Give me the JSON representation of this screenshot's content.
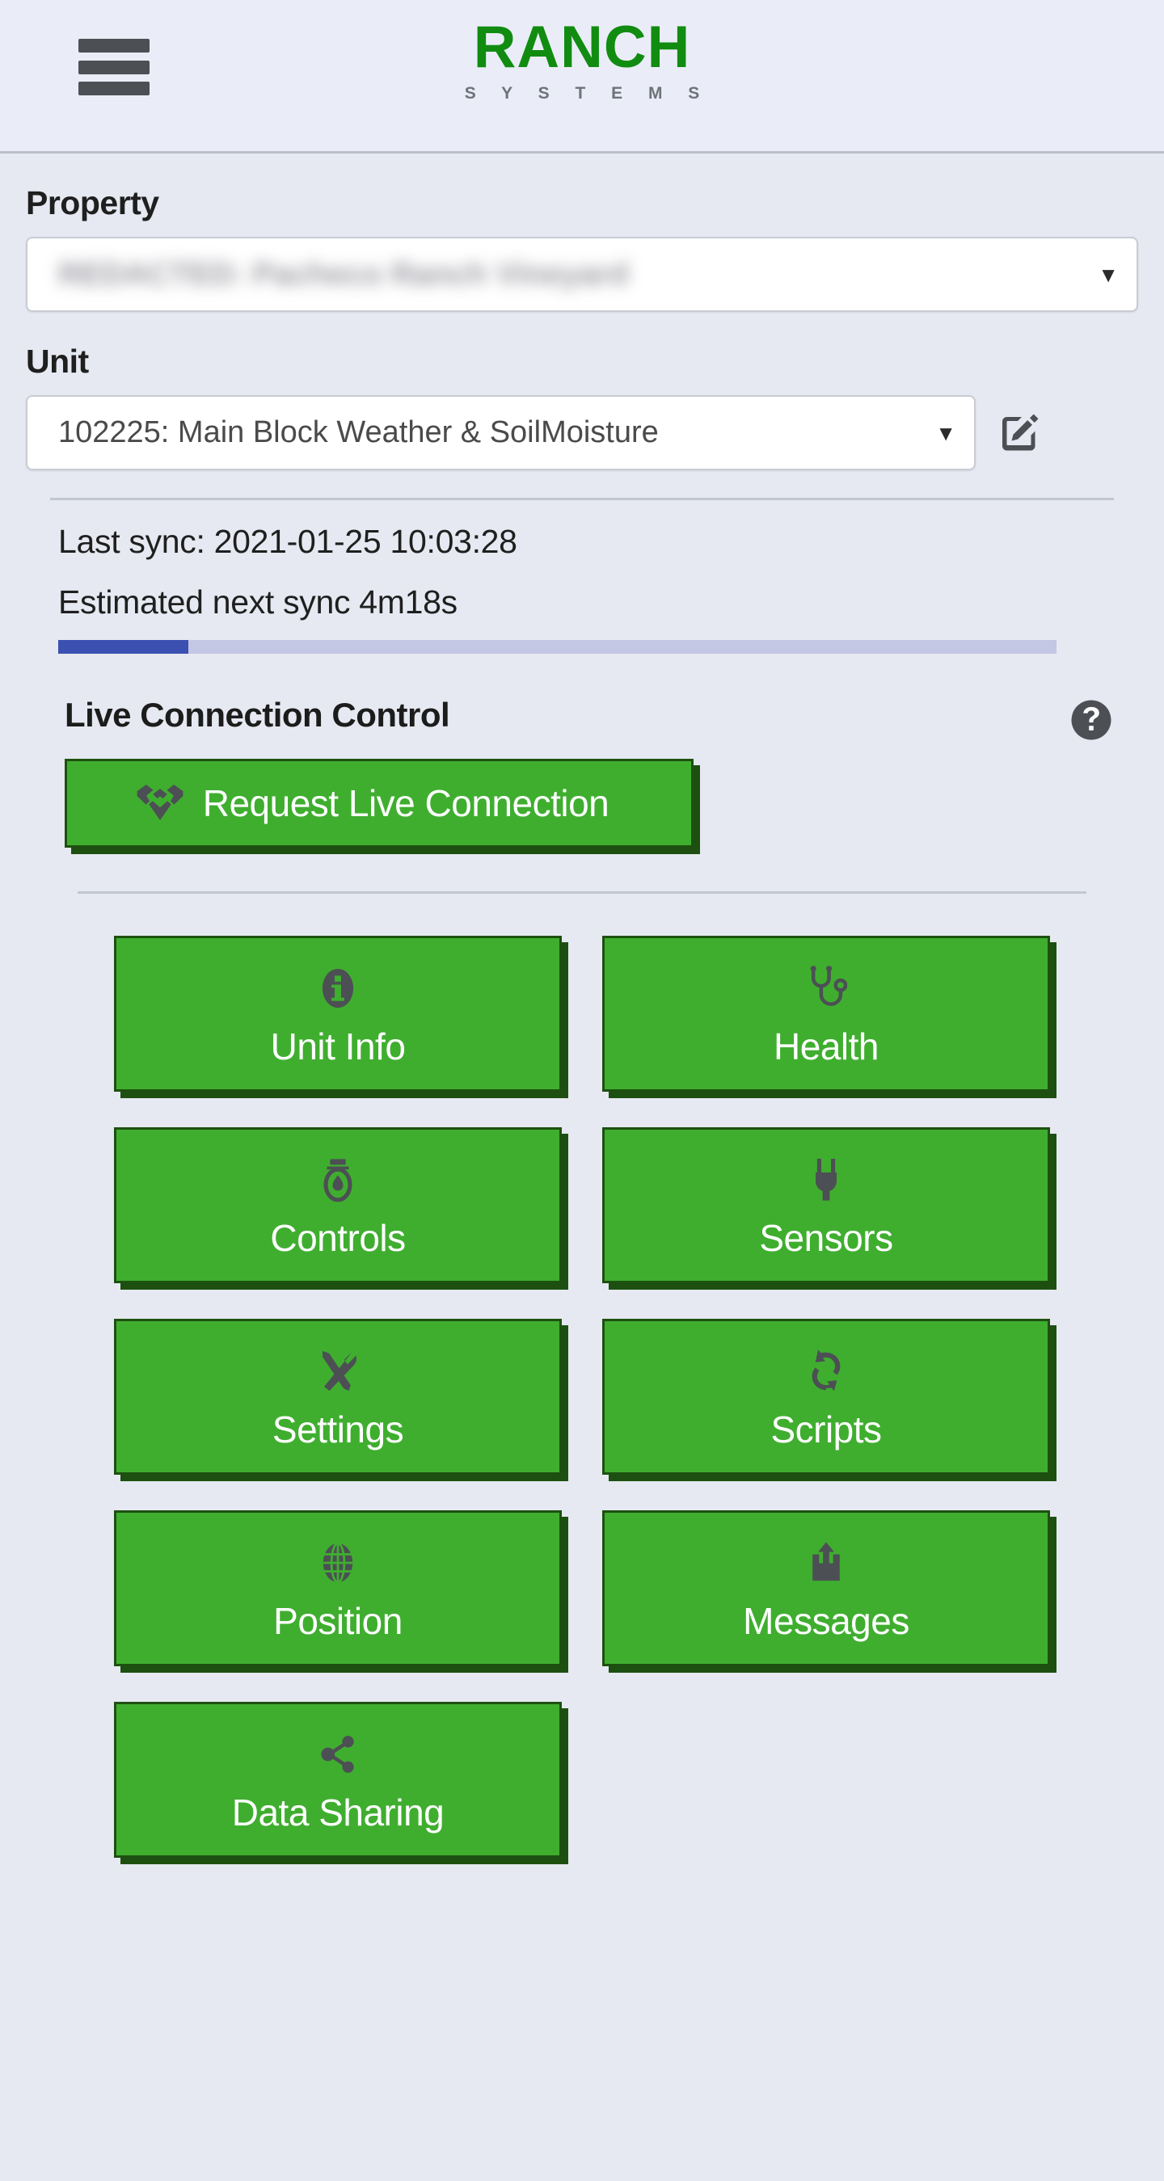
{
  "header": {
    "menu_icon": "hamburger-menu-icon",
    "brand_name": "RANCH",
    "brand_subtitle": "S Y S T E M S",
    "brand_color": "#118c11"
  },
  "property": {
    "label": "Property",
    "selected_value": "REDACTED: Pacheco Ranch Vineyard",
    "caret": "▼",
    "redacted": true
  },
  "unit": {
    "label": "Unit",
    "selected_value": "102225: Main Block Weather & SoilMoisture",
    "caret": "▼",
    "edit_icon": "edit-pencil-icon"
  },
  "sync": {
    "last_sync_text": "Last sync: 2021-01-25 10:03:28",
    "next_sync_text": "Estimated next sync 4m18s",
    "progress_percent": 13,
    "progress_fill_color": "#3b50b0",
    "progress_track_color": "#c3c7e4"
  },
  "live_connection": {
    "title": "Live Connection Control",
    "help_icon": "help-question-icon",
    "request_button": {
      "label": "Request Live Connection",
      "icon": "handshake-icon"
    }
  },
  "menu": {
    "button_color": "#3fae2f",
    "button_shadow_color": "#1d5010",
    "buttons": [
      {
        "label": "Unit Info",
        "icon": "info-circle-icon"
      },
      {
        "label": "Health",
        "icon": "stethoscope-icon"
      },
      {
        "label": "Controls",
        "icon": "valve-icon"
      },
      {
        "label": "Sensors",
        "icon": "power-plug-icon"
      },
      {
        "label": "Settings",
        "icon": "wrench-screwdriver-icon"
      },
      {
        "label": "Scripts",
        "icon": "refresh-cycle-icon"
      },
      {
        "label": "Position",
        "icon": "globe-icon"
      },
      {
        "label": "Messages",
        "icon": "inbox-upload-icon"
      },
      {
        "label": "Data Sharing",
        "icon": "share-nodes-icon"
      }
    ]
  }
}
